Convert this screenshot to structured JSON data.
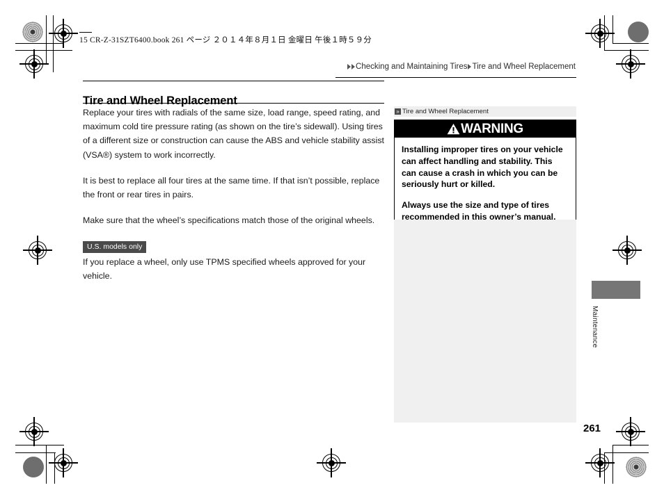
{
  "print_header": {
    "file_line": "15 CR-Z-31SZT6400.book   261 ページ   ２０１４年８月１日   金曜日   午後１時５９分"
  },
  "breadcrumb": {
    "arrow_icon": "double-triangle-right-icon",
    "parent": "Checking and Maintaining Tires",
    "separator_icon": "triangle-right-icon",
    "current": "Tire and Wheel Replacement"
  },
  "main": {
    "heading": "Tire and Wheel Replacement",
    "paragraphs": [
      "Replace your tires with radials of the same size, load range, speed rating, and maximum cold tire pressure rating (as shown on the tire’s sidewall). Using tires of a different size or construction can cause the ABS and vehicle stability assist (VSA®) system to work incorrectly.",
      "It is best to replace all four tires at the same time. If that isn’t possible, replace the front or rear tires in pairs.",
      "Make sure that the wheel’s specifications match those of the original wheels."
    ],
    "note": {
      "badge": "U.S. models only",
      "text": "If you replace a wheel, only use TPMS specified wheels approved for your vehicle."
    }
  },
  "sidebar": {
    "header": {
      "icon": "chevron-double-right-icon",
      "label": "Tire and Wheel Replacement"
    },
    "warning": {
      "icon": "warning-triangle-icon",
      "banner_label": "WARNING",
      "paragraphs": [
        "Installing improper tires on your vehicle can affect handling and stability. This can cause a crash in which you can be seriously hurt or killed.",
        "Always use the size and type of tires recommended in this owner’s manual."
      ]
    }
  },
  "edge_tab": {
    "label": "Maintenance",
    "bar_color": "#767676"
  },
  "footer": {
    "page_number": "261"
  },
  "colors": {
    "badge_bg": "#4a4a4a",
    "warning_banner_bg": "#000000",
    "sidebar_header_bg": "#efefef",
    "sidebar_fill_bg": "#f0f0f0"
  }
}
